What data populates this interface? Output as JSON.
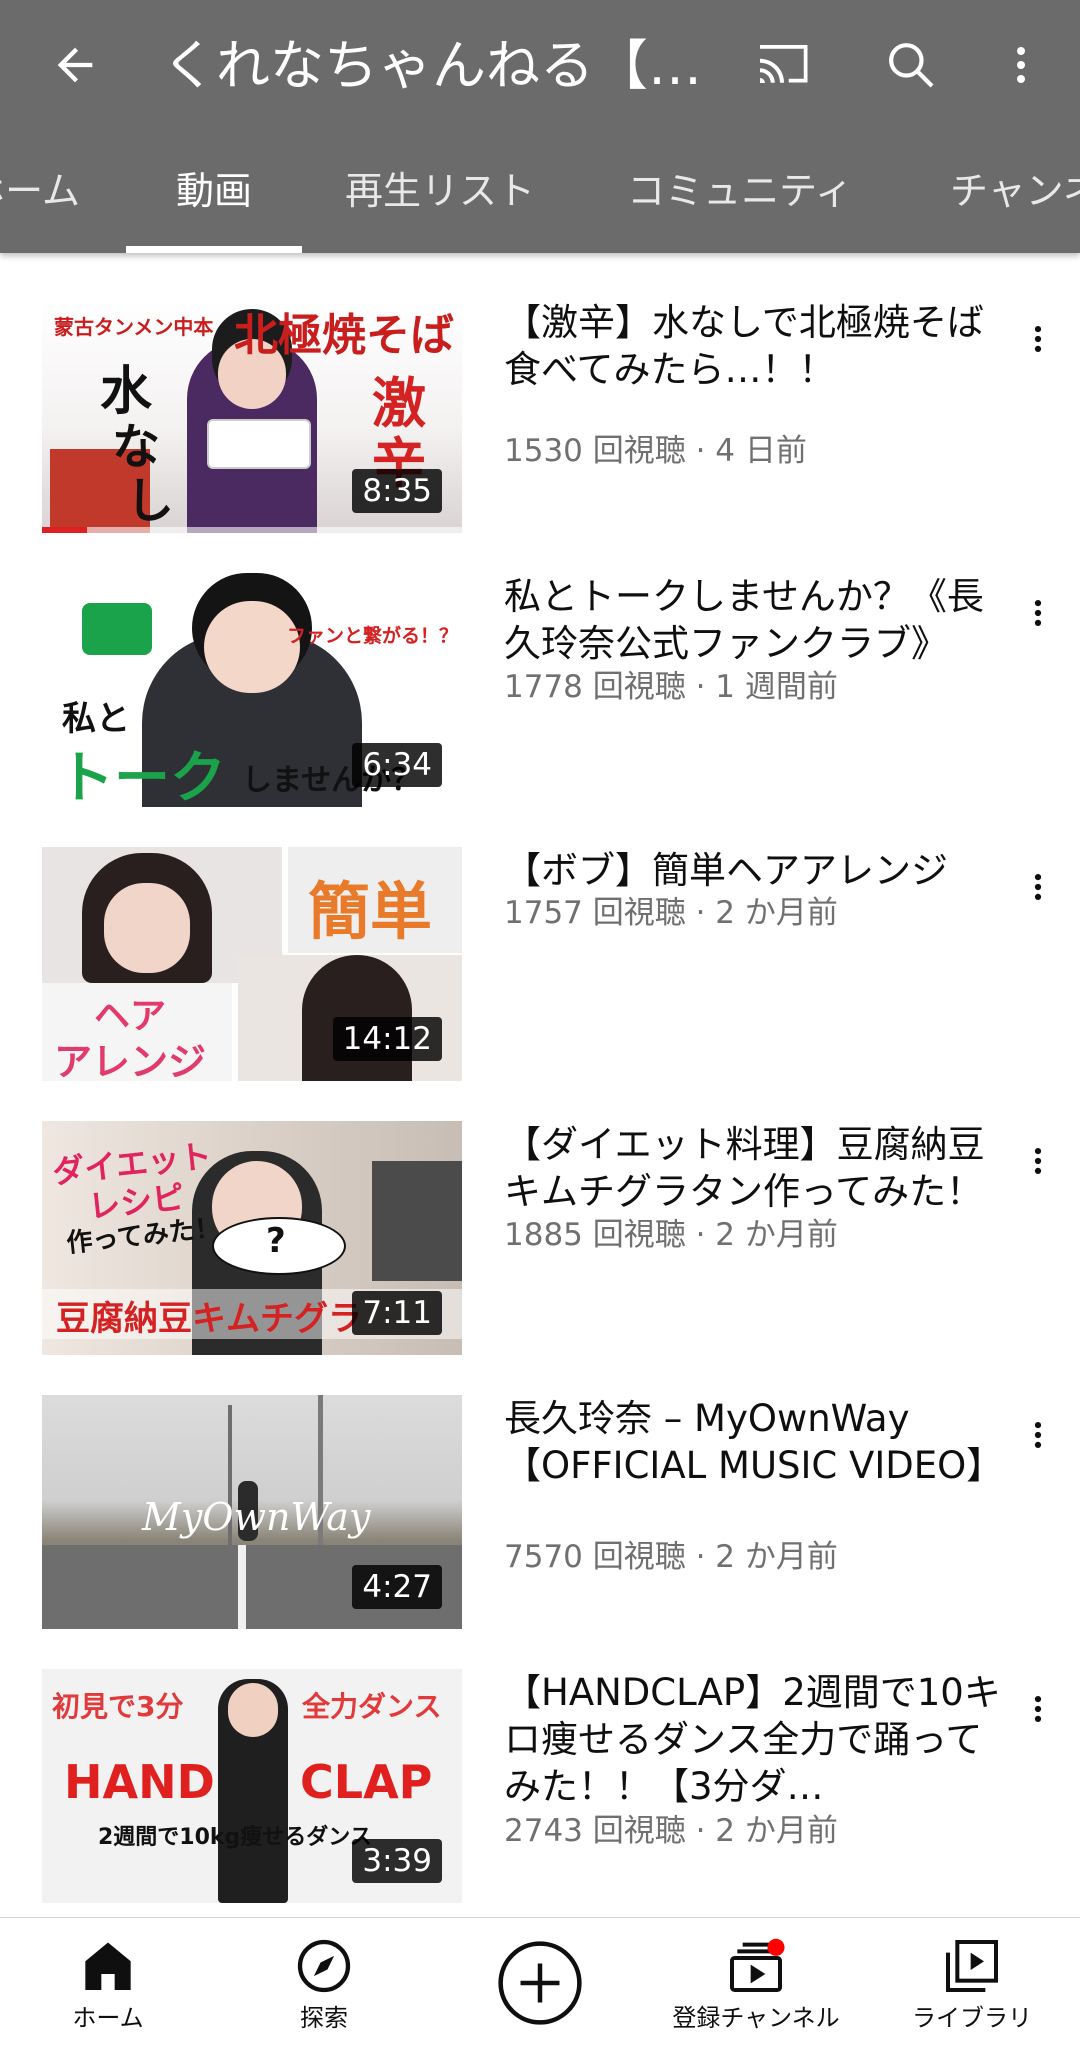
{
  "appbar": {
    "channel_title": "くれなちゃんねる【長…",
    "icons": [
      "back-arrow-icon",
      "cast-icon",
      "search-icon",
      "more-vert-icon"
    ]
  },
  "tabs": [
    {
      "label": "ホーム",
      "active": false
    },
    {
      "label": "動画",
      "active": true
    },
    {
      "label": "再生リスト",
      "active": false
    },
    {
      "label": "コミュニティ",
      "active": false
    },
    {
      "label": "チャンネル",
      "active": false
    }
  ],
  "videos": [
    {
      "title": "【激辛】水なしで北極焼そば食べてみたら…！！",
      "meta": "1530 回視聴 · 4 日前",
      "duration": "8:35",
      "thumb_text": [
        "蒙古タンメン中本",
        "北極焼そば",
        "水",
        "な",
        "し",
        "激",
        "辛"
      ]
    },
    {
      "title": "私とトークしませんか？《長久玲奈公式ファンクラブ》",
      "meta": "1778 回視聴 · 1 週間前",
      "duration": "6:34",
      "thumb_text": [
        "ファンと繋がる！？",
        "私と",
        "トーク",
        "しませんか？"
      ]
    },
    {
      "title": "【ボブ】簡単ヘアアレンジ",
      "meta": "1757 回視聴 · 2 か月前",
      "duration": "14:12",
      "thumb_text": [
        "簡単",
        "ヘア",
        "アレンジ"
      ]
    },
    {
      "title": "【ダイエット料理】豆腐納豆キムチグラタン作ってみた！",
      "meta": "1885 回視聴 · 2 か月前",
      "duration": "7:11",
      "thumb_text": [
        "ダイエット",
        "レシピ",
        "作ってみた！",
        "?",
        "豆腐納豆キムチグラ"
      ]
    },
    {
      "title": "長久玲奈 – MyOwnWay【OFFICIAL MUSIC VIDEO】",
      "meta": "7570 回視聴 · 2 か月前",
      "duration": "4:27",
      "thumb_text": [
        "MyOwnWay"
      ]
    },
    {
      "title": "【HANDCLAP】2週間で10キロ痩せるダンス全力で踊ってみた！！【3分ダ…",
      "meta": "2743 回視聴 · 2 か月前",
      "duration": "3:39",
      "thumb_text": [
        "初見で3分",
        "全力ダンス",
        "HAND",
        "CLAP",
        "2週間で10kg痩せるダンス"
      ]
    }
  ],
  "bottom_nav": [
    {
      "label": "ホーム",
      "icon": "home-icon"
    },
    {
      "label": "探索",
      "icon": "explore-icon"
    },
    {
      "label": "",
      "icon": "create-plus-icon"
    },
    {
      "label": "登録チャンネル",
      "icon": "subscriptions-icon"
    },
    {
      "label": "ライブラリ",
      "icon": "library-icon"
    }
  ],
  "colors": {
    "appbar_bg": "#6b6b6b",
    "meta_text": "#707070",
    "notification_dot": "#ff0000",
    "progress_red": "#e02020"
  }
}
